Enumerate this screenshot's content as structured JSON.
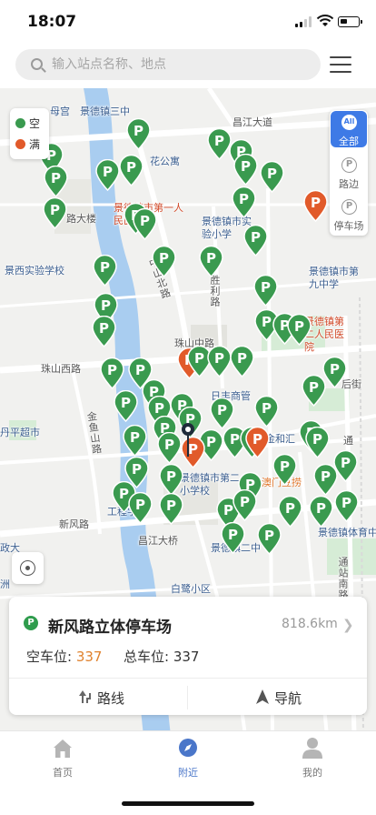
{
  "status_bar": {
    "time": "18:07"
  },
  "search": {
    "placeholder": "输入站点名称、地点"
  },
  "legend": {
    "items": [
      {
        "label": "空",
        "color": "#3a9a4f"
      },
      {
        "label": "满",
        "color": "#e15a2a"
      }
    ]
  },
  "filter": {
    "items": [
      {
        "icon": "All",
        "label": "全部",
        "active": true
      },
      {
        "icon": "P",
        "label": "路边",
        "active": false
      },
      {
        "icon": "P",
        "label": "停车场",
        "active": false
      }
    ]
  },
  "map": {
    "marker_letter": "P",
    "colors": {
      "free": "#3a9a4f",
      "full": "#e15a2a",
      "river": "#a9cdf0",
      "green": "#d2ecd2"
    },
    "labels": {
      "jingdezhen_no3": "景德镇三中",
      "changjiang_ave_top": "昌江大道",
      "road_block_building": "路大楼",
      "hospital_no1": "景德镇市第一人民医院",
      "experimental_primary": "景德镇市实验小学",
      "no9_middle": "景德镇市第九中学",
      "jingxi_experimental": "景西实验学校",
      "shengli_road": "胜利路",
      "zhongshan_north_road": "中山北路",
      "second_hospital": "景德镇第二人民医院",
      "zhushan_mid_road": "珠山中路",
      "zhushan_west_road": "珠山西路",
      "rifeng_mall": "日丰商管",
      "jinhe_huiling": "金和汇",
      "houjie": "后街",
      "jinyu_shan_road": "金鱼山路",
      "second_primary": "景德镇市第二小学校",
      "macau_douleo": "澳门豆捞",
      "xinfeng_road": "新风路",
      "changjiang_bridge": "昌江大桥",
      "jingdezhen_no2": "景德镇二中",
      "baiying_community": "白鹭小区",
      "tongzhan_south_road": "通站南路",
      "sports_center": "景德镇体育中",
      "ping_supermarket": "丹平超市",
      "engineering_college": "工程学院",
      "yinhua_apartment": "花公寓",
      "danmu": "母宫",
      "tong": "通",
      "zhengda": "政大",
      "zhou": "洲"
    }
  },
  "card": {
    "icon": "P",
    "name": "新风路立体停车场",
    "distance": "818.6km",
    "free_label": "空车位:",
    "free_value": "337",
    "total_label": "总车位:",
    "total_value": "337",
    "route_label": "路线",
    "nav_label": "导航"
  },
  "tabbar": {
    "items": [
      {
        "label": "首页",
        "icon": "home-icon",
        "active": false
      },
      {
        "label": "附近",
        "icon": "compass-icon",
        "active": true
      },
      {
        "label": "我的",
        "icon": "user-icon",
        "active": false
      }
    ]
  }
}
